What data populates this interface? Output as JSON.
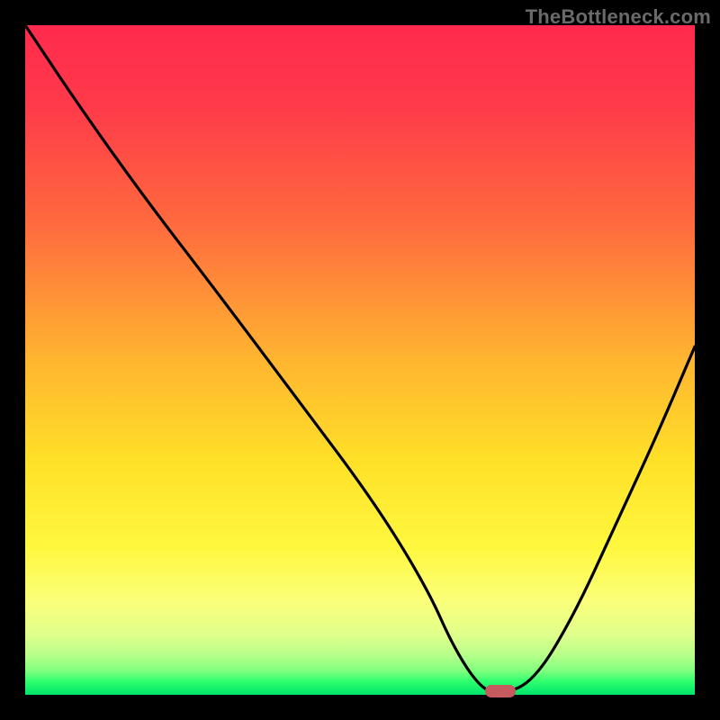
{
  "watermark": "TheBottleneck.com",
  "colors": {
    "page_bg": "#000000",
    "curve_stroke": "#000000",
    "marker_fill": "#c65a5f",
    "watermark_text": "#6a6a6a"
  },
  "chart_data": {
    "type": "line",
    "title": "",
    "xlabel": "",
    "ylabel": "",
    "xlim": [
      0,
      100
    ],
    "ylim": [
      0,
      100
    ],
    "grid": false,
    "series": [
      {
        "name": "bottleneck-curve",
        "x": [
          0,
          8,
          18,
          28,
          40,
          52,
          60,
          64,
          68,
          71,
          76,
          82,
          88,
          94,
          100
        ],
        "values": [
          100,
          88,
          74,
          61,
          45,
          29,
          16,
          7,
          1,
          0,
          2,
          12,
          25,
          38,
          52
        ]
      }
    ],
    "marker": {
      "x": 71,
      "y": 0.6
    },
    "background_gradient": {
      "type": "vertical",
      "stops": [
        {
          "pos": 0.0,
          "color": "#ff2a4d"
        },
        {
          "pos": 0.5,
          "color": "#ffb530"
        },
        {
          "pos": 0.8,
          "color": "#fff83f"
        },
        {
          "pos": 0.95,
          "color": "#9eff86"
        },
        {
          "pos": 1.0,
          "color": "#00e46a"
        }
      ]
    }
  }
}
